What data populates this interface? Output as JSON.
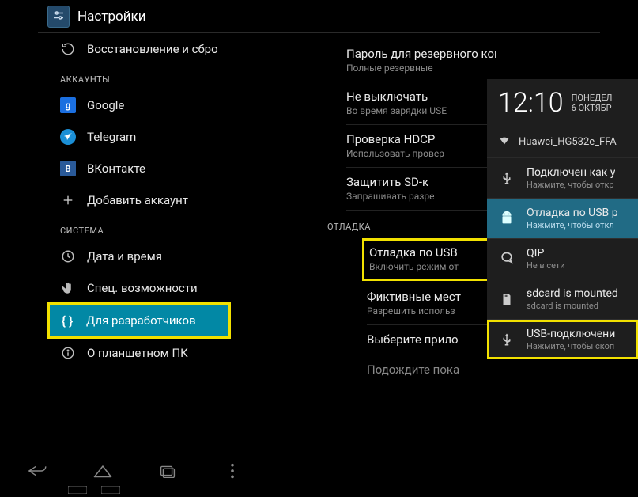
{
  "header": {
    "title": "Настройки"
  },
  "left": {
    "backup_restore": "Восстановление и сбро",
    "section_accounts": "АККАУНТЫ",
    "acc_google": "Google",
    "acc_telegram": "Telegram",
    "acc_vk": "ВКонтакте",
    "add_account": "Добавить аккаунт",
    "section_system": "СИСТЕМА",
    "date_time": "Дата и время",
    "accessibility": "Спец. возможности",
    "developer": "Для разработчиков",
    "about_tablet": "О планшетном ПК"
  },
  "right": {
    "pwd_title": "Пароль для резервного копирования",
    "pwd_sub": "Полные резервные",
    "stay_awake_title": "Не выключать",
    "stay_awake_sub": "Во время зарядки USE",
    "hdcp_title": "Проверка HDCP",
    "hdcp_sub": "Использовать провер",
    "sd_title": "Защитить SD-к",
    "sd_sub": "Запрашивать разре",
    "section_debug": "ОТЛАДКА",
    "usb_debug_title": "Отладка по USB",
    "usb_debug_sub": "Включить режим от",
    "mock_title": "Фиктивные мест",
    "mock_sub": "Разрешить использ",
    "select_app_title": "Выберите прило",
    "wait_title": "Подождите пока"
  },
  "notif": {
    "time": "12:10",
    "day": "ПОНЕДЕЛ",
    "date": "6 ОКТЯБР",
    "wifi": "Huawei_HG532e_FFA",
    "n1_title": "Подключен как у",
    "n1_sub": "Нажмите, чтобы откр",
    "n2_title": "Отладка по USB р",
    "n2_sub": "Нажмите, чтобы откл",
    "n3_title": "QIP",
    "n3_sub": "Не в сети",
    "n4_title": "sdcard is mounted",
    "n4_sub": "sdcard is mounted",
    "n5_title": "USB-подключени",
    "n5_sub": "Нажмите, чтобы скоп"
  }
}
